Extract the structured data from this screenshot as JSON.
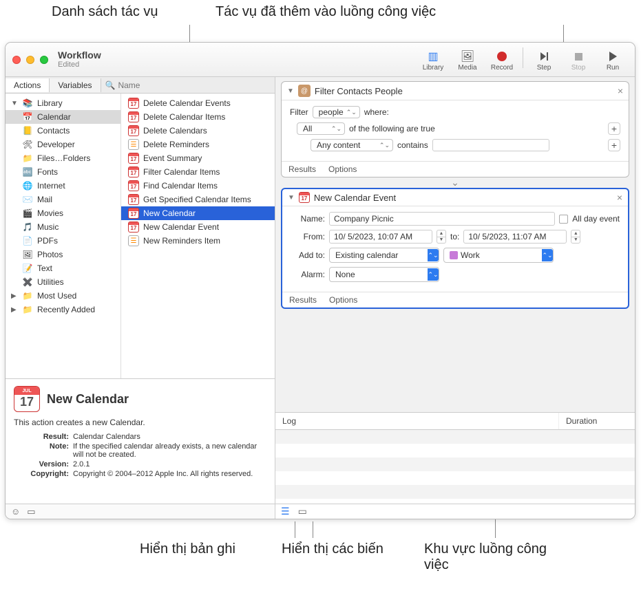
{
  "annotations": {
    "top_left": "Danh sách tác vụ",
    "top_right": "Tác vụ đã thêm vào luồng công việc",
    "bottom_left": "Hiển thị bản ghi",
    "bottom_mid": "Hiển thị các biến",
    "bottom_right": "Khu vực luồng công việc"
  },
  "window": {
    "title": "Workflow",
    "subtitle": "Edited",
    "toolbar": {
      "library": "Library",
      "media": "Media",
      "record": "Record",
      "step": "Step",
      "stop": "Stop",
      "run": "Run"
    }
  },
  "tabs": {
    "actions": "Actions",
    "variables": "Variables"
  },
  "search_placeholder": "Name",
  "library": {
    "root": "Library",
    "items": [
      "Calendar",
      "Contacts",
      "Developer",
      "Files…Folders",
      "Fonts",
      "Internet",
      "Mail",
      "Movies",
      "Music",
      "PDFs",
      "Photos",
      "Text",
      "Utilities"
    ],
    "extra": [
      "Most Used",
      "Recently Added"
    ],
    "selected_index": 0
  },
  "actions": {
    "items": [
      "Delete Calendar Events",
      "Delete Calendar Items",
      "Delete Calendars",
      "Delete Reminders",
      "Event Summary",
      "Filter Calendar Items",
      "Find Calendar Items",
      "Get Specified Calendar Items",
      "New Calendar",
      "New Calendar Event",
      "New Reminders Item"
    ],
    "selected_index": 8
  },
  "info": {
    "icon_day": "17",
    "title": "New Calendar",
    "desc": "This action creates a new Calendar.",
    "rows": [
      {
        "k": "Result:",
        "v": "Calendar Calendars"
      },
      {
        "k": "Note:",
        "v": "If the specified calendar already exists, a new calendar will not be created."
      },
      {
        "k": "Version:",
        "v": "2.0.1"
      },
      {
        "k": "Copyright:",
        "v": "Copyright © 2004–2012 Apple Inc.  All rights reserved."
      }
    ]
  },
  "workflow": {
    "filter": {
      "title": "Filter Contacts People",
      "filter_label": "Filter",
      "filter_target": "people",
      "where": "where:",
      "all": "All",
      "of_following": "of the following are true",
      "any_content": "Any content",
      "contains": "contains",
      "contains_value": "",
      "results": "Results",
      "options": "Options"
    },
    "newcal": {
      "title": "New Calendar Event",
      "name_label": "Name:",
      "name_value": "Company Picnic",
      "allday_label": "All day event",
      "from_label": "From:",
      "from_value": "10/ 5/2023, 10:07 AM",
      "to_label": "to:",
      "to_value": "10/ 5/2023, 11:07 AM",
      "addto_label": "Add to:",
      "addto_value": "Existing calendar",
      "cal_name": "Work",
      "alarm_label": "Alarm:",
      "alarm_value": "None",
      "results": "Results",
      "options": "Options"
    }
  },
  "log": {
    "log_col": "Log",
    "dur_col": "Duration"
  }
}
